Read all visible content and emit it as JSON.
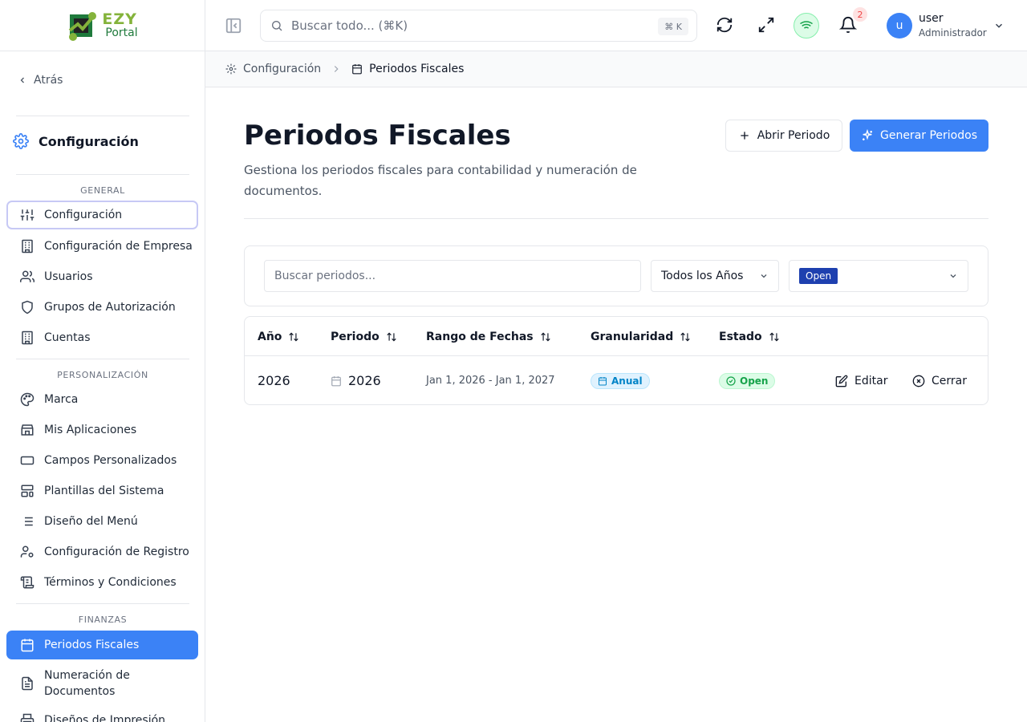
{
  "app": {
    "logo_primary": "EZY",
    "logo_secondary": "Portal",
    "logo_colors": {
      "green": "#84b33b",
      "dark_green": "#1f7a3c"
    }
  },
  "sidebar": {
    "back_label": "Atrás",
    "title": "Configuración",
    "sections": {
      "general": "GENERAL",
      "personalizacion": "PERSONALIZACIÓN",
      "finanzas": "FINANZAS"
    },
    "items": [
      {
        "label": "Configuración",
        "icon": "sliders-icon",
        "state": "focused"
      },
      {
        "label": "Configuración de Empresa",
        "icon": "building-icon"
      },
      {
        "label": "Usuarios",
        "icon": "users-icon"
      },
      {
        "label": "Grupos de Autorización",
        "icon": "shield-icon"
      },
      {
        "label": "Cuentas",
        "icon": "building-icon"
      },
      {
        "label": "Marca",
        "icon": "palette-icon"
      },
      {
        "label": "Mis Aplicaciones",
        "icon": "store-icon"
      },
      {
        "label": "Campos Personalizados",
        "icon": "input-field-icon"
      },
      {
        "label": "Plantillas del Sistema",
        "icon": "layout-template-icon"
      },
      {
        "label": "Diseño del Menú",
        "icon": "list-icon"
      },
      {
        "label": "Configuración de Registro",
        "icon": "user-cog-icon"
      },
      {
        "label": "Términos y Condiciones",
        "icon": "scroll-icon"
      },
      {
        "label": "Periodos Fiscales",
        "icon": "calendar-icon",
        "state": "active"
      },
      {
        "label": "Numeración de Documentos",
        "icon": "file-text-icon"
      },
      {
        "label": "Diseños de Impresión",
        "icon": "printer-icon"
      }
    ]
  },
  "topbar": {
    "search_placeholder": "Buscar todo... (⌘K)",
    "search_shortcut": "⌘ K",
    "notification_count": "2",
    "user": {
      "initial": "u",
      "name": "user",
      "role": "Administrador"
    }
  },
  "breadcrumb": {
    "parent": "Configuración",
    "current": "Periodos Fiscales"
  },
  "page": {
    "title": "Periodos Fiscales",
    "description": "Gestiona los periodos fiscales para contabilidad y numeración de documentos.",
    "btn_open": "Abrir Periodo",
    "btn_generate": "Generar Periodos"
  },
  "filters": {
    "search_placeholder": "Buscar periodos...",
    "year_value": "Todos los Años",
    "status_tag": "Open"
  },
  "table": {
    "headers": [
      "Año",
      "Periodo",
      "Rango de Fechas",
      "Granularidad",
      "Estado"
    ],
    "rows": [
      {
        "year": "2026",
        "period": "2026",
        "range": "Jan 1, 2026 - Jan 1, 2027",
        "granularity": "Anual",
        "status": "Open",
        "edit_label": "Editar",
        "close_label": "Cerrar"
      }
    ]
  },
  "colors": {
    "accent": "#3b82f6",
    "active_tag": "#1e40af",
    "success": "#16a34a",
    "info": "#0284c7"
  }
}
